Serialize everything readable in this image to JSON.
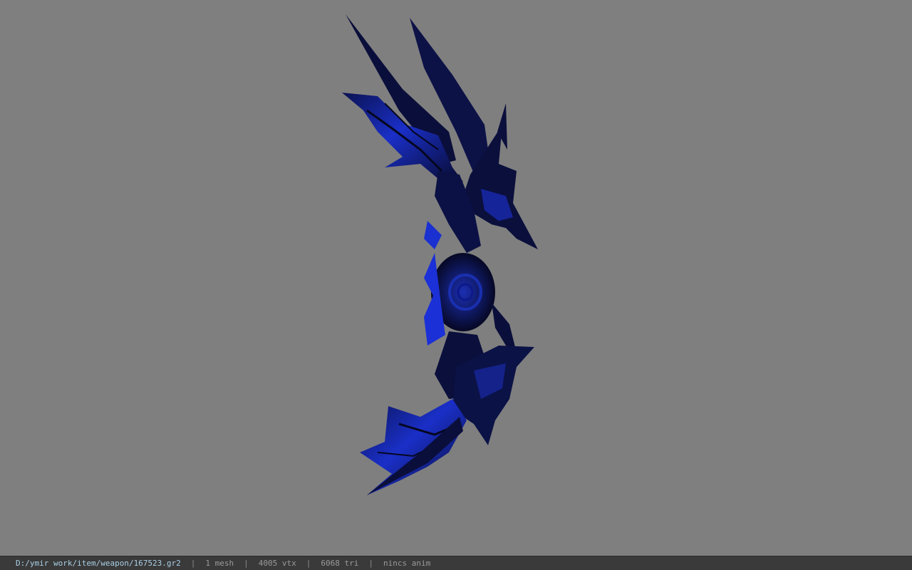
{
  "viewport": {
    "background_color": "#7f7f7f",
    "model": {
      "icon": "dragon-wing-bow-model",
      "primary_color": "#0a0f3c",
      "highlight_color": "#1a32d8"
    }
  },
  "statusbar": {
    "file_path": "D:/ymir work/item/weapon/167523.gr2",
    "separator": "|",
    "mesh": "1 mesh",
    "vertices": "4005 vtx",
    "triangles": "6068 tri",
    "animation": "nincs anim"
  }
}
